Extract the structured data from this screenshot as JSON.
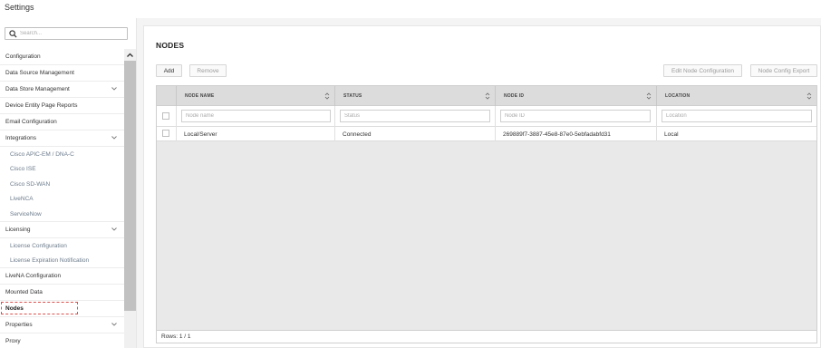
{
  "app": {
    "title": "Settings"
  },
  "search": {
    "placeholder": "Search..."
  },
  "sidebar": {
    "items": [
      {
        "label": "Configuration",
        "type": "item"
      },
      {
        "label": "Data Source Management",
        "type": "item"
      },
      {
        "label": "Data Store Management",
        "type": "group"
      },
      {
        "label": "Device Entity Page Reports",
        "type": "item"
      },
      {
        "label": "Email Configuration",
        "type": "item"
      },
      {
        "label": "Integrations",
        "type": "group"
      },
      {
        "label": "Cisco APIC-EM / DNA-C",
        "type": "sub"
      },
      {
        "label": "Cisco ISE",
        "type": "sub"
      },
      {
        "label": "Cisco SD-WAN",
        "type": "sub"
      },
      {
        "label": "LiveNCA",
        "type": "sub"
      },
      {
        "label": "ServiceNow",
        "type": "sub"
      },
      {
        "label": "Licensing",
        "type": "group"
      },
      {
        "label": "License Configuration",
        "type": "sub"
      },
      {
        "label": "License Expiration Notification",
        "type": "sub"
      },
      {
        "label": "LiveNA Configuration",
        "type": "item"
      },
      {
        "label": "Mounted Data",
        "type": "item"
      },
      {
        "label": "Nodes",
        "type": "selected"
      },
      {
        "label": "Properties",
        "type": "group"
      },
      {
        "label": "Proxy",
        "type": "item"
      }
    ]
  },
  "main": {
    "title": "NODES",
    "toolbar": {
      "add_label": "Add",
      "remove_label": "Remove",
      "edit_label": "Edit Node Configuration",
      "export_label": "Node Config Export"
    },
    "grid": {
      "columns": [
        "NODE NAME",
        "STATUS",
        "NODE ID",
        "LOCATION"
      ],
      "filter_placeholders": [
        "Node name",
        "Status",
        "Node ID",
        "Location"
      ],
      "rows": [
        [
          "Local/Server",
          "Connected",
          "269889f7-3887-45e8-87e0-5ebfadabfd31",
          "Local"
        ]
      ],
      "footer": "Rows: 1 / 1"
    }
  },
  "colors": {
    "header_bg": "#dcdcdc",
    "grid_bg": "#e9e9e9",
    "scroll_thumb": "#c1c1c1",
    "selection_outline": "#d9534f",
    "sub_item_text": "#6b7a8a"
  }
}
